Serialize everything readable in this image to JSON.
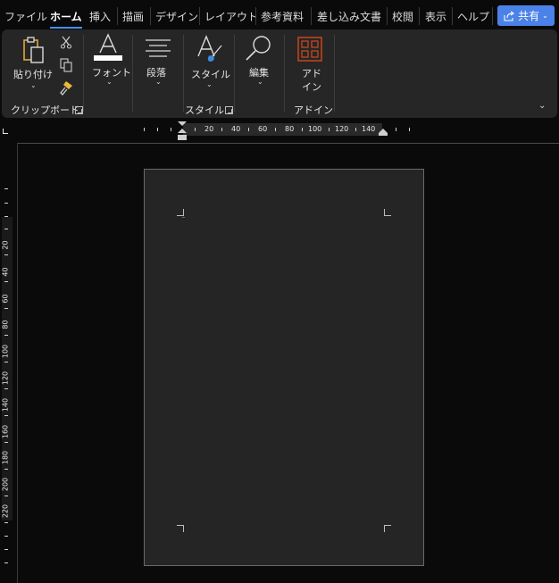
{
  "tabs": [
    "ファイル",
    "ホーム",
    "挿入",
    "描画",
    "デザイン",
    "レイアウト",
    "参考資料",
    "差し込み文書",
    "校閲",
    "表示",
    "ヘルプ"
  ],
  "share_label": "共有",
  "ribbon": {
    "paste_label": "貼り付け",
    "clipboard_group_label": "クリップボード",
    "font_label": "フォント",
    "paragraph_label": "段落",
    "styles_label": "スタイル",
    "styles_group_label": "スタイル",
    "editing_label": "編集",
    "addin_label_line1": "アド",
    "addin_label_line2": "イン",
    "addin_group_label": "アドイン"
  },
  "ruler": {
    "horizontal_numbers": [
      "20",
      "40",
      "60",
      "80",
      "100",
      "120",
      "140"
    ],
    "vertical_numbers": [
      "20",
      "40",
      "60",
      "80",
      "100",
      "120",
      "140",
      "160",
      "180",
      "200",
      "220"
    ]
  },
  "colors": {
    "accent": "#4c8df6",
    "share_button": "#4a82e8",
    "addin_icon": "#d24a1e",
    "brush": "#e8b93a",
    "clipboard": "#e2a83a"
  },
  "icons": [
    "cut-icon",
    "copy-icon",
    "format-painter-icon",
    "paste-icon",
    "font-icon",
    "paragraph-icon",
    "styles-icon",
    "search-icon",
    "addin-icon",
    "share-icon"
  ]
}
